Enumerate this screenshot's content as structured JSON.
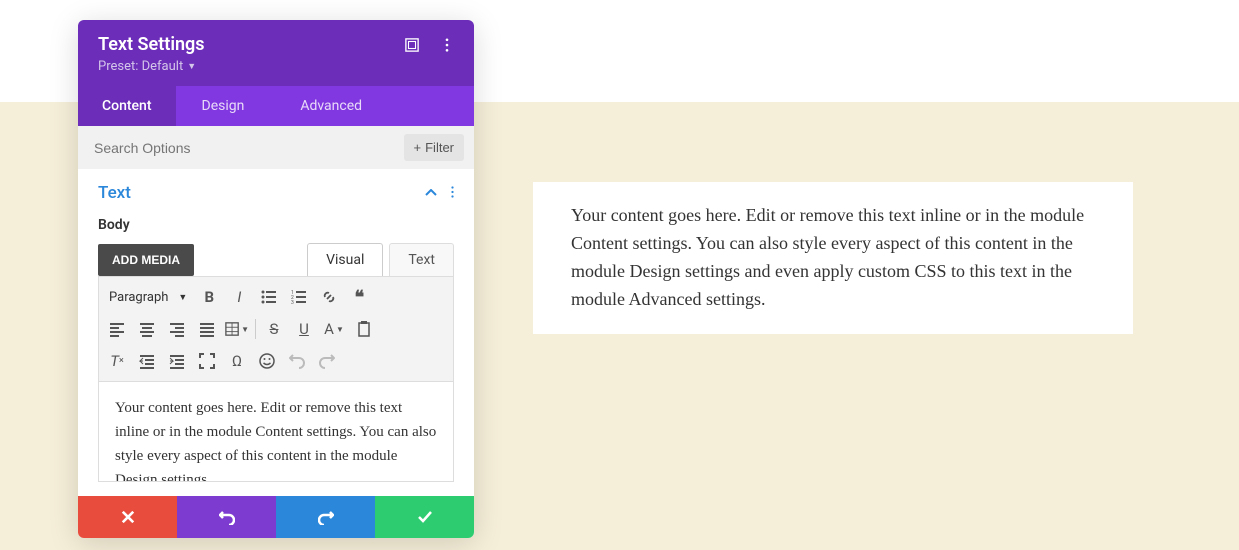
{
  "header": {
    "title": "Text Settings",
    "preset_label": "Preset: Default"
  },
  "tabs": {
    "content": "Content",
    "design": "Design",
    "advanced": "Advanced"
  },
  "search": {
    "placeholder": "Search Options",
    "filter_label": "Filter"
  },
  "section": {
    "title": "Text",
    "body_label": "Body",
    "add_media": "ADD MEDIA",
    "editor_tabs": {
      "visual": "Visual",
      "text": "Text"
    },
    "paragraph_select": "Paragraph",
    "editor_content": "Your content goes here. Edit or remove this text inline or in the module Content settings. You can also style every aspect of this content in the module Design settings"
  },
  "preview": {
    "text": "Your content goes here. Edit or remove this text inline or in the module Content settings. You can also style every aspect of this content in the module Design settings and even apply custom CSS to this text in the module Advanced settings."
  }
}
